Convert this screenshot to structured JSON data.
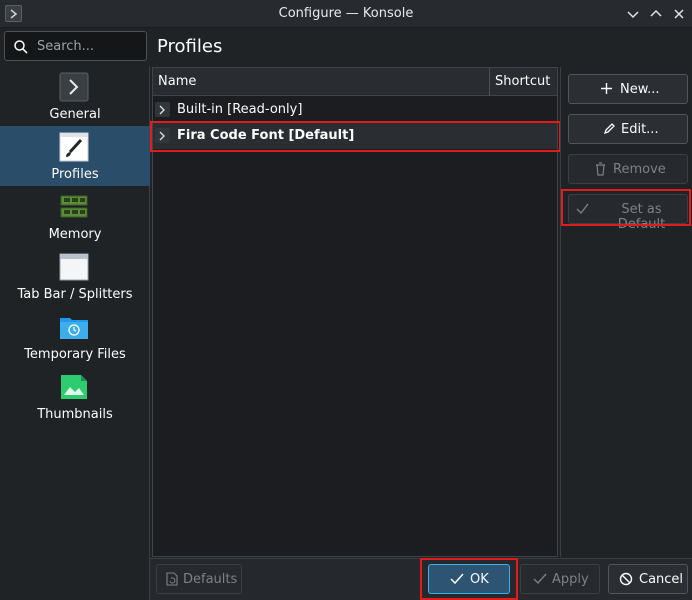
{
  "window": {
    "title": "Configure — Konsole"
  },
  "search": {
    "placeholder": "Search..."
  },
  "sidebar": {
    "items": [
      {
        "label": "General",
        "icon": "chevron-right-icon"
      },
      {
        "label": "Profiles",
        "icon": "brush-icon",
        "selected": true
      },
      {
        "label": "Memory",
        "icon": "memory-icon"
      },
      {
        "label": "Tab Bar / Splitters",
        "icon": "window-icon"
      },
      {
        "label": "Temporary Files",
        "icon": "folder-clock-icon"
      },
      {
        "label": "Thumbnails",
        "icon": "image-icon"
      }
    ]
  },
  "page": {
    "title": "Profiles"
  },
  "table": {
    "columns": [
      "Name",
      "Shortcut"
    ],
    "rows": [
      {
        "name": "Built-in [Read-only]",
        "shortcut": ""
      },
      {
        "name": "Fira Code Font [Default]",
        "shortcut": "",
        "bold": true
      }
    ]
  },
  "actions": {
    "new_label": "New...",
    "edit_label": "Edit...",
    "remove_label": "Remove",
    "set_default_label": "Set as Default"
  },
  "footer": {
    "defaults_label": "Defaults",
    "ok_label": "OK",
    "apply_label": "Apply",
    "cancel_label": "Cancel"
  },
  "colors": {
    "accent": "#3daee9",
    "selection": "#2a4d69",
    "highlight": "#e21c1c",
    "background": "#202326"
  }
}
